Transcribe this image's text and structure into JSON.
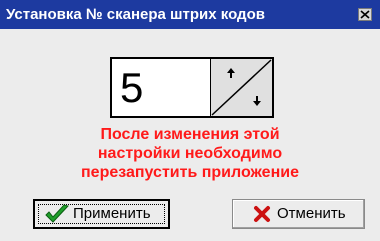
{
  "window": {
    "title": "Установка № сканера штрих кодов"
  },
  "spinner": {
    "value": "5"
  },
  "warning": {
    "lines": [
      "После изменения этой",
      "настройки необходимо",
      "перезапустить приложение"
    ]
  },
  "buttons": {
    "apply_label": "Применить",
    "cancel_label": "Отменить"
  },
  "icons": {
    "apply": "checkmark-icon",
    "cancel": "cross-icon",
    "close": "close-icon",
    "up": "arrow-up-icon",
    "down": "arrow-down-icon"
  },
  "colors": {
    "titlebar": "#1d3aa0",
    "warning_text": "#ff1a1a",
    "check_green": "#1f9e2a",
    "cross_red": "#cc1111"
  }
}
